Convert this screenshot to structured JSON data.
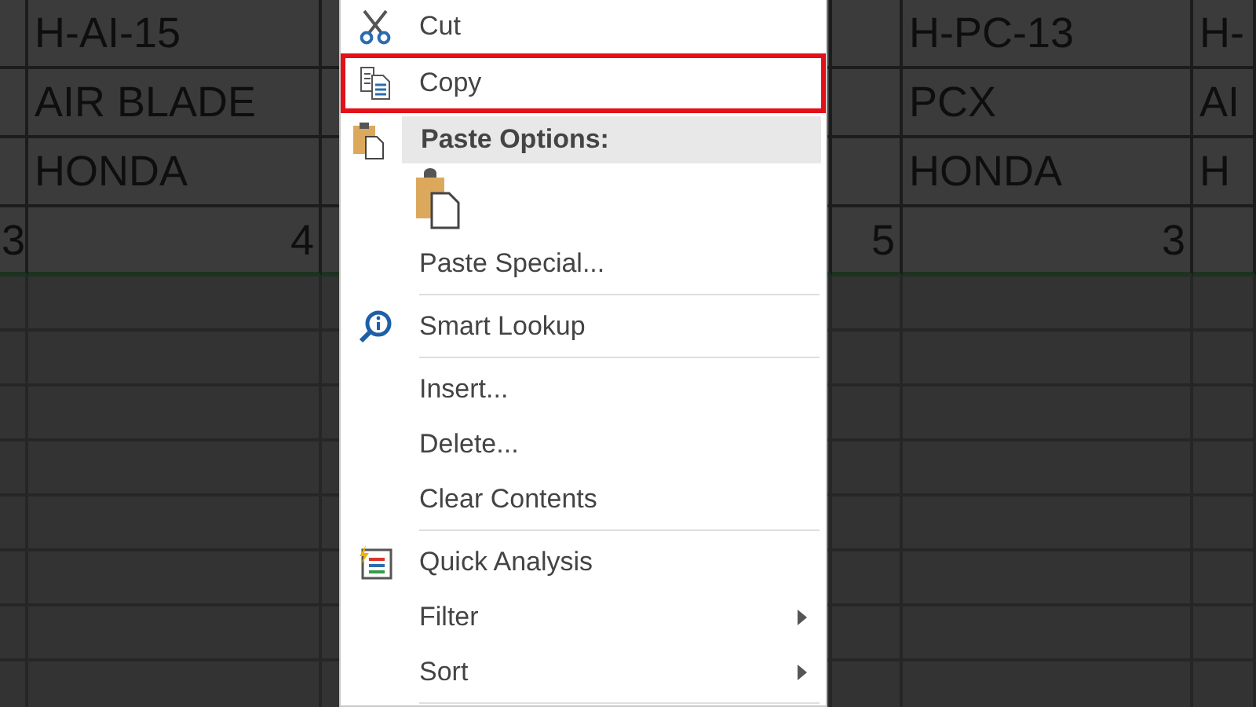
{
  "sheet": {
    "rows": [
      {
        "cells": [
          null,
          {
            "text": "H-AI-15",
            "kind": "text"
          },
          null,
          null,
          {
            "text": "H-PC-13",
            "kind": "text"
          },
          {
            "text": "H-",
            "kind": "text"
          }
        ]
      },
      {
        "cells": [
          null,
          {
            "text": "AIR BLADE",
            "kind": "text"
          },
          null,
          null,
          {
            "text": "PCX",
            "kind": "text"
          },
          {
            "text": "AI",
            "kind": "text"
          }
        ]
      },
      {
        "cells": [
          null,
          {
            "text": "HONDA",
            "kind": "text"
          },
          null,
          null,
          {
            "text": "HONDA",
            "kind": "text"
          },
          {
            "text": "H",
            "kind": "text"
          }
        ]
      },
      {
        "cells": [
          {
            "text": "3",
            "kind": "number"
          },
          {
            "text": "4",
            "kind": "number"
          },
          null,
          {
            "text": "5",
            "kind": "number"
          },
          {
            "text": "3",
            "kind": "number"
          },
          null
        ]
      }
    ]
  },
  "context_menu": {
    "items": [
      {
        "kind": "item",
        "label": "Cut",
        "highlighted": false,
        "submenu": false
      },
      {
        "kind": "item",
        "label": "Copy",
        "highlighted": true,
        "submenu": false
      },
      {
        "kind": "header",
        "label": "Paste Options:"
      },
      {
        "kind": "paste-icons"
      },
      {
        "kind": "item",
        "label": "Paste Special...",
        "highlighted": false,
        "submenu": false
      },
      {
        "kind": "separator"
      },
      {
        "kind": "item",
        "label": "Smart Lookup",
        "highlighted": false,
        "submenu": false
      },
      {
        "kind": "separator"
      },
      {
        "kind": "item",
        "label": "Insert...",
        "highlighted": false,
        "submenu": false
      },
      {
        "kind": "item",
        "label": "Delete...",
        "highlighted": false,
        "submenu": false
      },
      {
        "kind": "item",
        "label": "Clear Contents",
        "highlighted": false,
        "submenu": false
      },
      {
        "kind": "separator"
      },
      {
        "kind": "item",
        "label": "Quick Analysis",
        "highlighted": false,
        "submenu": false
      },
      {
        "kind": "item",
        "label": "Filter",
        "highlighted": false,
        "submenu": true
      },
      {
        "kind": "item",
        "label": "Sort",
        "highlighted": false,
        "submenu": true
      },
      {
        "kind": "separator"
      }
    ]
  }
}
